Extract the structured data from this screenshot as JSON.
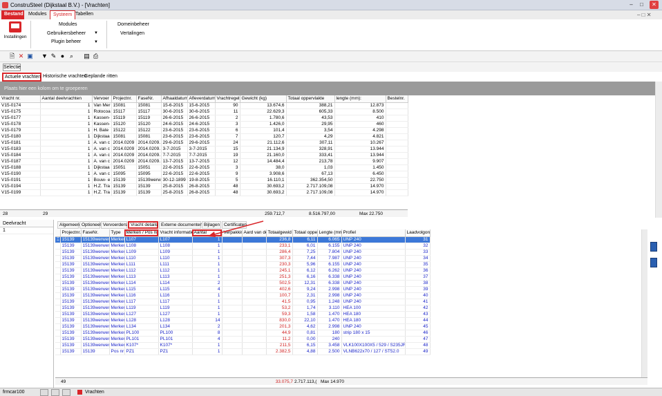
{
  "window": {
    "title": "ConstruSteel (Dijkstaal B.V.) - [Vrachten]"
  },
  "menu": {
    "tabs": [
      "Bestand",
      "Modules",
      "Systeem",
      "Tabellen"
    ],
    "active": "Systeem"
  },
  "ribbon": {
    "installingen": "Installingen",
    "modules": "Modules",
    "gebruikersbeheer": "Gebruikersbeheer",
    "plugin_beheer": "Plugin beheer",
    "domeinbeheer": "Domeinbeheer",
    "vertalingen": "Vertalingen"
  },
  "selectie": "Selectie",
  "subtabs": [
    "Actuele vrachten",
    "Historische vrachten",
    "Geplande ritten"
  ],
  "groupbar": "Plaats hier een kolom om te groeperen",
  "upper_grid": {
    "columns": [
      "Vracht nr.",
      "Aantal deelvrachten",
      "Vervoer",
      "Projectnr.",
      "FaseNr.",
      "Afhaaldatum",
      "Afleverdatum",
      "Vrachtregels",
      "Gewicht (kg)",
      "Totaal oppervlakte",
      "lengte (mm):",
      "Bestelnr."
    ],
    "rows": [
      [
        "V15-0174",
        "1",
        "Van Mer",
        "15081",
        "15081",
        "15-6-2015",
        "15-6-2015",
        "90",
        "13.674,6",
        "388,21",
        "12.873",
        ""
      ],
      [
        "V15-0175",
        "1",
        "Rotocoa",
        "15117",
        "15117",
        "30-6-2015",
        "30-6-2015",
        "11",
        "22.629,3",
        "605,33",
        "8.500",
        ""
      ],
      [
        "V15-0177",
        "1",
        "Kassen-",
        "15119",
        "15119",
        "26-6-2015",
        "26-6-2015",
        "2",
        "1.780,6",
        "43,53",
        "410",
        ""
      ],
      [
        "V15-0178",
        "1",
        "Kassen-",
        "15120",
        "15120",
        "24-6-2015",
        "24-6-2015",
        "3",
        "1.426,0",
        "29,95",
        "460",
        ""
      ],
      [
        "V15-0179",
        "1",
        "H. Bate",
        "15122",
        "15122",
        "23-6-2015",
        "23-6-2015",
        "6",
        "101,4",
        "3,54",
        "4.298",
        ""
      ],
      [
        "V15-0180",
        "1",
        "Dijkstaa",
        "15081",
        "15081",
        "23-6-2015",
        "23-6-2015",
        "7",
        "120,7",
        "4,29",
        "4.821",
        ""
      ],
      [
        "V15-0181",
        "1",
        "A. van c",
        "2014.0209",
        "2014.0209.",
        "29-6-2015",
        "29-6-2015",
        "24",
        "21.112,6",
        "307,11",
        "10.267",
        ""
      ],
      [
        "V15-0183",
        "1",
        "A. van c",
        "2014.0209",
        "2014.0209.",
        "3-7-2015",
        "3-7-2015",
        "15",
        "21.134,9",
        "328,91",
        "13.944",
        ""
      ],
      [
        "V15-0184",
        "1",
        "A. van c",
        "2014.0209",
        "2014.0209.",
        "7-7-2015",
        "7-7-2015",
        "19",
        "21.160,0",
        "333,41",
        "13.944",
        ""
      ],
      [
        "V15-0187",
        "1",
        "A. van c",
        "2014.0209",
        "2014.0209.",
        "13-7-2015",
        "13-7-2015",
        "12",
        "14.484,4",
        "213,78",
        "9.907",
        ""
      ],
      [
        "V15-0188",
        "1",
        "Dijkstaa",
        "15051",
        "15051",
        "22-6-2015",
        "22-6-2015",
        "3",
        "38,0",
        "1,03",
        "1.450",
        ""
      ],
      [
        "V15-0190",
        "1",
        "A. van c",
        "15095",
        "15095",
        "22-6-2015",
        "22-6-2015",
        "9",
        "3.908,6",
        "67,13",
        "6.450",
        ""
      ],
      [
        "V15-0191",
        "1",
        "Bouw- e",
        "15139",
        "15139werw",
        "30-12-1899",
        "19-8-2015",
        "5",
        "16.110,1",
        "362.354,50",
        "22.750",
        ""
      ],
      [
        "V15-0194",
        "1",
        "H.Z. Tra",
        "15139",
        "15139",
        "25-8-2015",
        "26-8-2015",
        "48",
        "30.693,2",
        "2.717.109,08",
        "14.970",
        ""
      ],
      [
        "V15-0199",
        "1",
        "H.Z. Tra",
        "15139",
        "15139",
        "25-8-2015",
        "26-8-2015",
        "48",
        "30.693,2",
        "2.717.109,08",
        "14.970",
        ""
      ]
    ],
    "footer": {
      "count": "28",
      "deel": "29",
      "gewicht": "259.712,7",
      "oppervlakte": "8.516.797,00",
      "lengte": "Max 22.750"
    }
  },
  "deelvracht": {
    "header": "Deelvracht",
    "value": "1"
  },
  "detail_tabs": [
    "Algemeen",
    "Optioneel",
    "Vervoerders",
    "Vracht details",
    "Externe documenten",
    "Bijlagen",
    "Certificaten"
  ],
  "detail_active": "Vracht details",
  "lower_grid": {
    "columns": [
      "Projectnr.",
      "FaseNr.",
      "Type",
      "Merken / Pos nr",
      "Vracht informatie",
      "Aantal",
      "Verpakking",
      "Aard van de",
      "Totaalgewid",
      "Totaal oppen",
      "Lengte (mm)",
      "Profiel",
      "Laadvolgord"
    ],
    "rows": [
      [
        "15139",
        "15139werwer",
        "Merken",
        "L107",
        "L107",
        "1",
        "",
        "",
        "236,8",
        "6,11",
        "6.065",
        "UNP 240",
        "31"
      ],
      [
        "15139",
        "15139werwer",
        "Merken",
        "L108",
        "L108",
        "1",
        "",
        "",
        "233,1",
        "6,01",
        "6.155",
        "UNP 240",
        "32"
      ],
      [
        "15139",
        "15139werwer",
        "Merken",
        "L109",
        "L109",
        "1",
        "",
        "",
        "286,4",
        "7,25",
        "7.804",
        "UNP 240",
        "33"
      ],
      [
        "15139",
        "15139werwer",
        "Merken",
        "L110",
        "L110",
        "1",
        "",
        "",
        "307,3",
        "7,44",
        "7.987",
        "UNP 240",
        "34"
      ],
      [
        "15139",
        "15139werwer",
        "Merken",
        "L111",
        "L111",
        "1",
        "",
        "",
        "230,3",
        "5,96",
        "6.155",
        "UNP 240",
        "35"
      ],
      [
        "15139",
        "15139werwer",
        "Merken",
        "L112",
        "L112",
        "1",
        "",
        "",
        "245,1",
        "6,12",
        "6.262",
        "UNP 240",
        "36"
      ],
      [
        "15139",
        "15139werwer",
        "Merken",
        "L113",
        "L113",
        "1",
        "",
        "",
        "251,3",
        "6,16",
        "6.338",
        "UNP 240",
        "37"
      ],
      [
        "15139",
        "15139werwer",
        "Merken",
        "L114",
        "L114",
        "2",
        "",
        "",
        "502,5",
        "12,31",
        "6.338",
        "UNP 240",
        "38"
      ],
      [
        "15139",
        "15139werwer",
        "Merken",
        "L115",
        "L115",
        "4",
        "",
        "",
        "402,6",
        "9,24",
        "2.998",
        "UNP 240",
        "39"
      ],
      [
        "15139",
        "15139werwer",
        "Merken",
        "L116",
        "L116",
        "1",
        "",
        "",
        "100,7",
        "2,31",
        "2.998",
        "UNP 240",
        "40"
      ],
      [
        "15139",
        "15139werwer",
        "Merken",
        "L117",
        "L117",
        "1",
        "",
        "",
        "41,5",
        "0,95",
        "1.248",
        "UNP 240",
        "41"
      ],
      [
        "15139",
        "15139werwer",
        "Merken",
        "L119",
        "L119",
        "1",
        "",
        "",
        "53,2",
        "1,74",
        "3.110",
        "HEA 100",
        "42"
      ],
      [
        "15139",
        "15139werwer",
        "Merken",
        "L127",
        "L127",
        "1",
        "",
        "",
        "59,3",
        "1,58",
        "1.470",
        "HEA 180",
        "43"
      ],
      [
        "15139",
        "15139werwer",
        "Merken",
        "L128",
        "L128",
        "14",
        "",
        "",
        "830,0",
        "22,10",
        "1.470",
        "HEA 180",
        "44"
      ],
      [
        "15139",
        "15139werwer",
        "Merken",
        "L134",
        "L134",
        "2",
        "",
        "",
        "201,3",
        "4,62",
        "2.998",
        "UNP 240",
        "45"
      ],
      [
        "15139",
        "15139werwer",
        "Merken",
        "PL100",
        "PL100",
        "8",
        "",
        "",
        "44,9",
        "0,81",
        "180",
        "strip 180 x 15",
        "46"
      ],
      [
        "15139",
        "15139werwer",
        "Merken",
        "PL101",
        "PL101",
        "4",
        "",
        "",
        "11,2",
        "0,00",
        "240",
        "",
        "47"
      ],
      [
        "15139",
        "15139werwer",
        "Merken",
        "K107*",
        "K107*",
        "1",
        "",
        "",
        "211,5",
        "6,15",
        "3.458",
        "VLK100X100X5 / 529 / S235JRH",
        "48"
      ],
      [
        "15139",
        "15139",
        "Pos nr",
        "PZ1",
        "PZ1",
        "1",
        "",
        "",
        "2.382,5",
        "4,88",
        "2.500",
        "VLNB622x70 / 127 / ST52.0",
        "49"
      ]
    ],
    "footer": {
      "count": "49",
      "gewicht": "33.075,7",
      "opp": "2.717.113,(",
      "lengte": "Max 14.970"
    }
  },
  "status": {
    "user": "frmcar100",
    "tab": "Vrachten"
  }
}
